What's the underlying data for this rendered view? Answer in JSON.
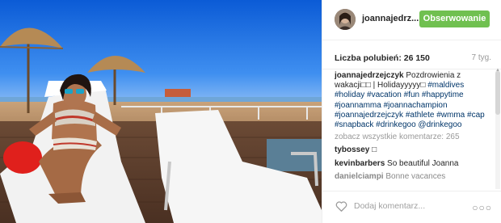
{
  "post": {
    "username": "joannajedrz...",
    "follow_label": "Obserwowanie",
    "likes": "Liczba polubień: 26 150",
    "age": "7 tyg.",
    "caption": {
      "user": "joannajedrzejczyk",
      "text": " Pozdrowienia z wakacji□□ | Holidayyyyy□",
      "hashtags": [
        "#maldives",
        "#holiday",
        "#vacation",
        "#fun",
        "#happytime",
        "#joannamma",
        "#joannachampion",
        "#joannajedrzejczyk",
        "#athlete",
        "#wmma",
        "#cap",
        "#snapback",
        "#drinkegoo",
        "@drinkegoo"
      ]
    },
    "view_all": "zobacz wszystkie komentarze: 265",
    "comments": [
      {
        "user": "tybossey",
        "text": " □"
      },
      {
        "user": "kevinbarbers",
        "text": " So beautiful Joanna"
      },
      {
        "user": "danielciampi",
        "text": " Bonne vacances"
      }
    ],
    "comment_placeholder": "Dodaj komentarz...",
    "more_label": "○○○"
  },
  "colors": {
    "follow_button": "#70c050",
    "hashtag": "#003569",
    "muted": "#999999"
  },
  "icons": {
    "like": "heart-icon",
    "more": "more-options-icon"
  }
}
